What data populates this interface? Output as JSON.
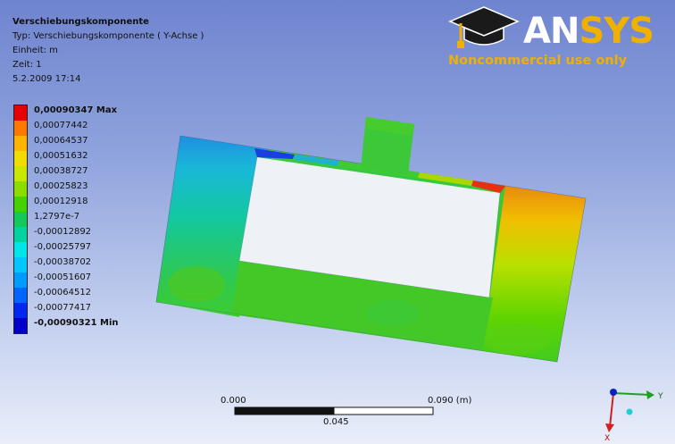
{
  "info": {
    "title": "Verschiebungskomponente",
    "type_line": "Typ: Verschiebungskomponente ( Y-Achse )",
    "unit_line": "Einheit: m",
    "time_line": "Zeit: 1",
    "date_line": "5.2.2009 17:14"
  },
  "logo": {
    "brand_a": "AN",
    "brand_b": "SYS",
    "tagline": "Noncommercial use only"
  },
  "legend": {
    "entries": [
      {
        "label": "0,00090347 Max",
        "color": "#e60000"
      },
      {
        "label": "0,00077442",
        "color": "#ff7800"
      },
      {
        "label": "0,00064537",
        "color": "#ffb400"
      },
      {
        "label": "0,00051632",
        "color": "#f0dc00"
      },
      {
        "label": "0,00038727",
        "color": "#c8e600"
      },
      {
        "label": "0,00025823",
        "color": "#8cdc00"
      },
      {
        "label": "0,00012918",
        "color": "#46d200"
      },
      {
        "label": "1,2797e-7",
        "color": "#14c85a"
      },
      {
        "label": "-0,00012892",
        "color": "#00d2a0"
      },
      {
        "label": "-0,00025797",
        "color": "#00e6e6"
      },
      {
        "label": "-0,00038702",
        "color": "#00c8ff"
      },
      {
        "label": "-0,00051607",
        "color": "#009bff"
      },
      {
        "label": "-0,00064512",
        "color": "#0064ff"
      },
      {
        "label": "-0,00077417",
        "color": "#0028f0"
      },
      {
        "label": "-0,00090321 Min",
        "color": "#0000c8"
      }
    ]
  },
  "scale": {
    "left": "0.000",
    "right": "0.090 (m)",
    "mid": "0.045"
  },
  "triad": {
    "y_label": "Y",
    "x_label": "X"
  }
}
